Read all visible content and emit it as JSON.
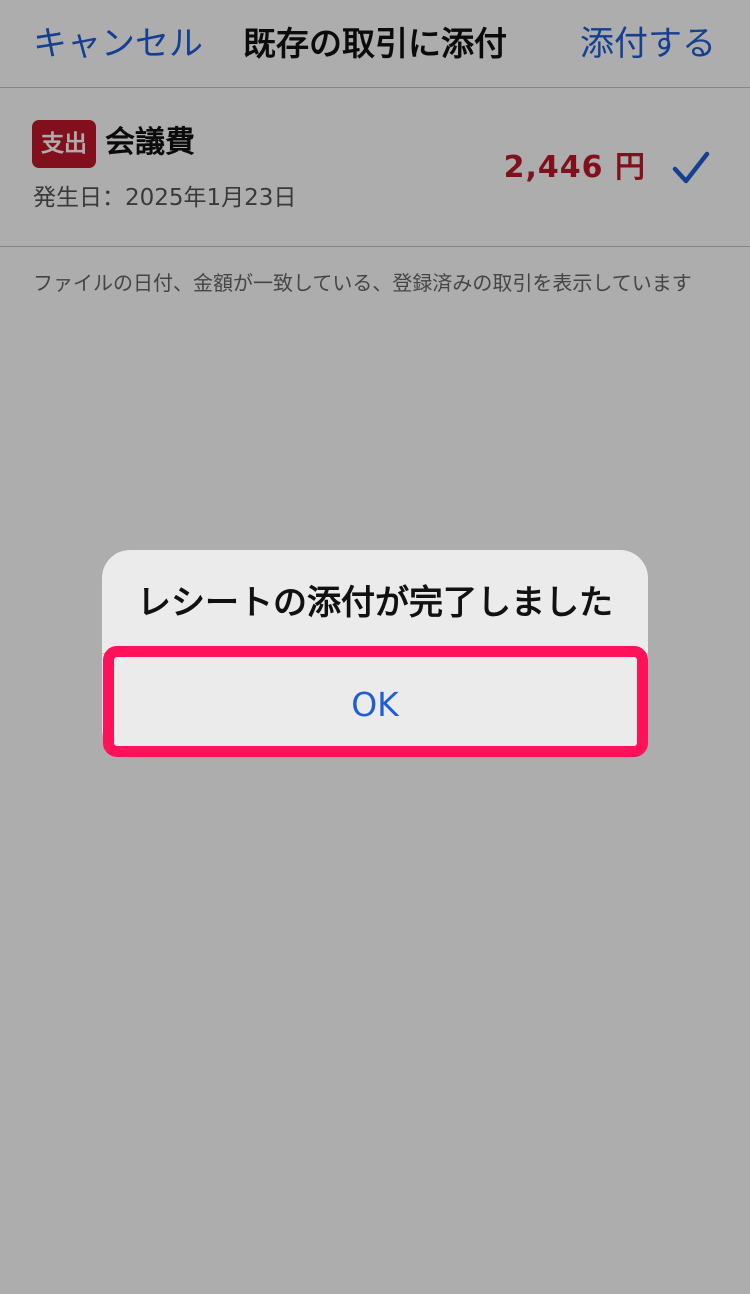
{
  "navbar": {
    "cancel_label": "キャンセル",
    "title": "既存の取引に添付",
    "attach_label": "添付する"
  },
  "transaction": {
    "badge": "支出",
    "title": "会議費",
    "date": "発生日：2025年1月23日",
    "amount": "2,446 円",
    "checked": true
  },
  "note": "ファイルの日付、金額が一致している、登録済みの取引を表示しています",
  "alert": {
    "title": "レシートの添付が完了しました",
    "ok_label": "OK"
  },
  "colors": {
    "accent_blue": "#1f5ed6",
    "expense_red": "#c0182a",
    "highlight_pink": "#ff1259"
  }
}
